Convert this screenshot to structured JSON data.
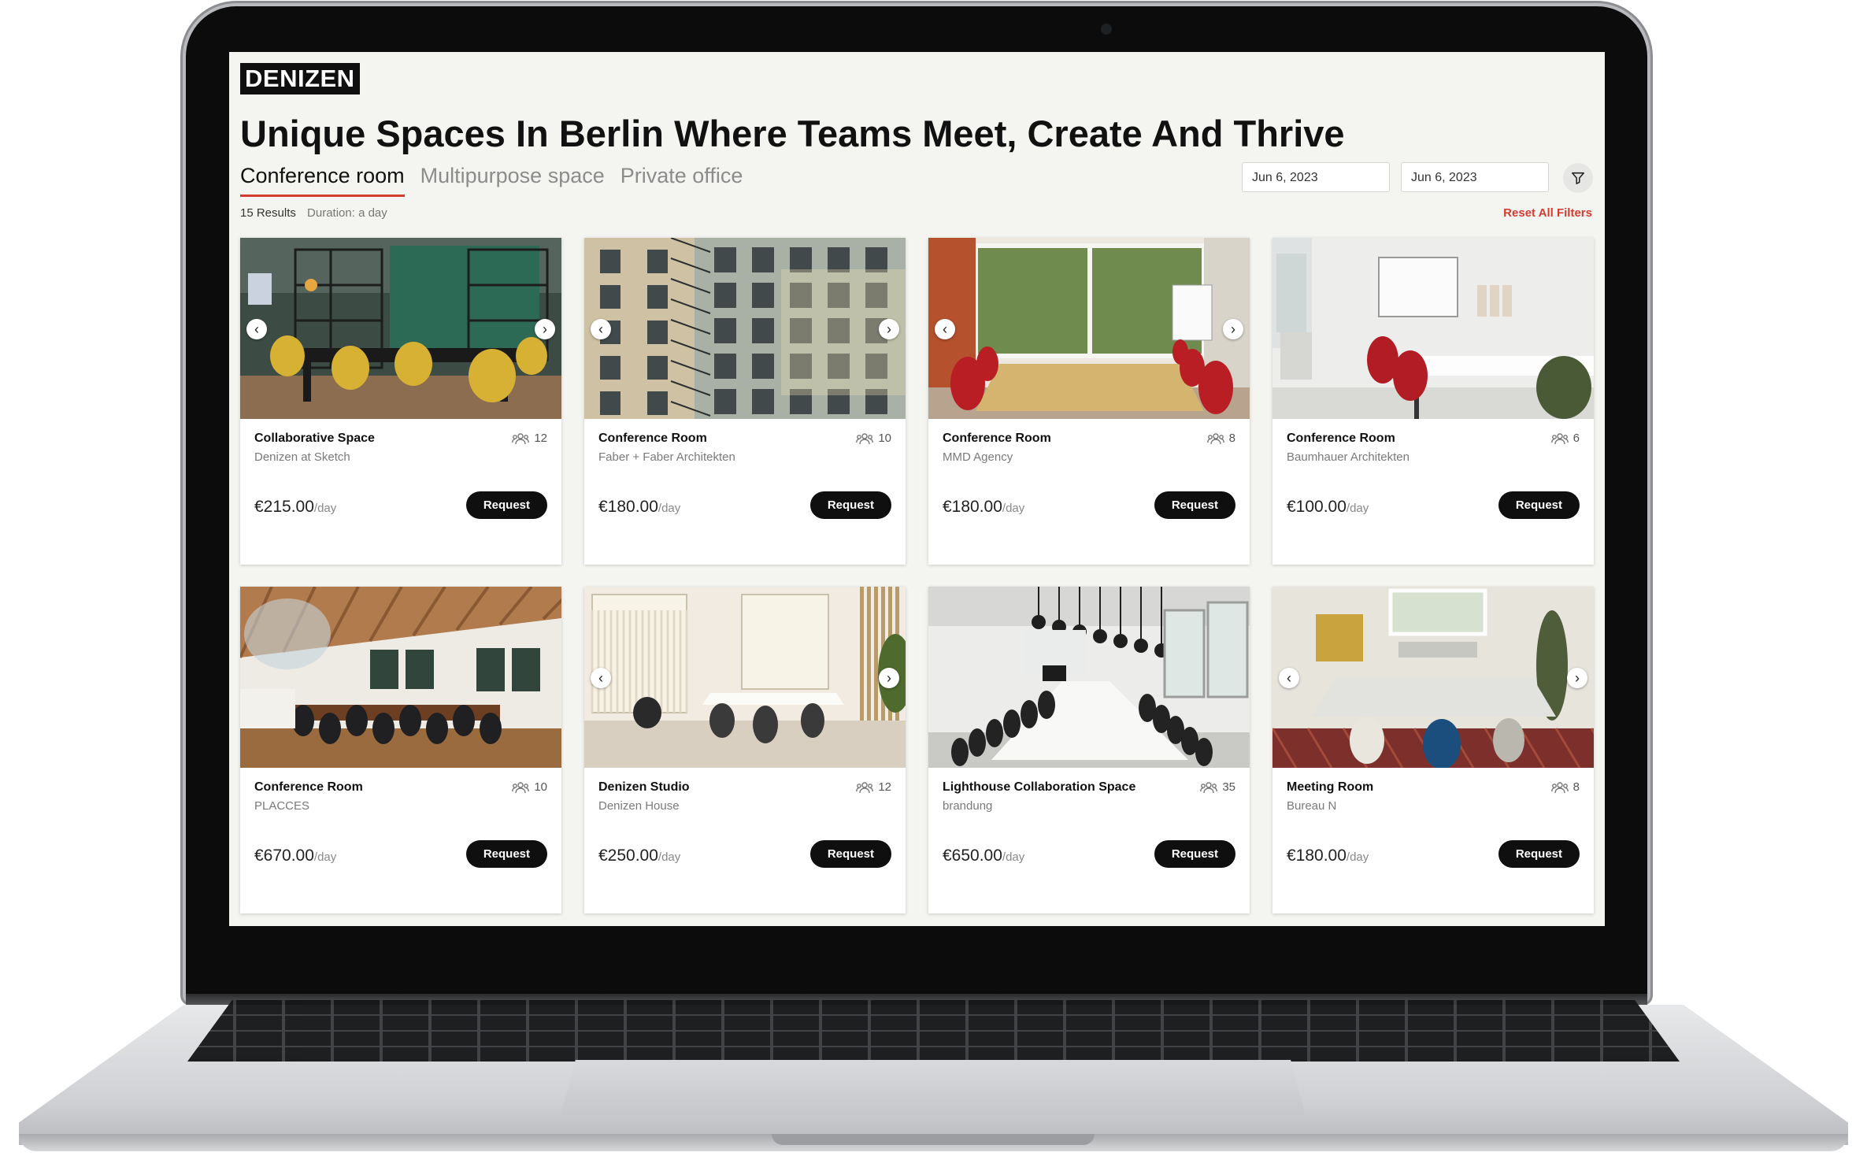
{
  "brand": {
    "logo_text": "DENIZEN"
  },
  "headline": "Unique Spaces In Berlin Where Teams Meet, Create And Thrive",
  "tabs": [
    {
      "label": "Conference room",
      "active": true
    },
    {
      "label": "Multipurpose space",
      "active": false
    },
    {
      "label": "Private office",
      "active": false
    }
  ],
  "dates": {
    "from": "Jun 6, 2023",
    "to": "Jun 6, 2023"
  },
  "results": {
    "count_text": "15 Results",
    "duration_text": "Duration: a day"
  },
  "reset_label": "Reset All Filters",
  "accent_color": "#d43c2f",
  "request_label": "Request",
  "price_unit": "/day",
  "listings": [
    {
      "title": "Collaborative Space",
      "host": "Denizen at Sketch",
      "capacity": "12",
      "price": "€215.00",
      "photo": "green-loft-yellow-chairs",
      "arrows": true
    },
    {
      "title": "Conference Room",
      "host": "Faber + Faber Architekten",
      "capacity": "10",
      "price": "€180.00",
      "photo": "building-courtyard",
      "arrows": true
    },
    {
      "title": "Conference Room",
      "host": "MMD Agency",
      "capacity": "8",
      "price": "€180.00",
      "photo": "red-chairs-table",
      "arrows": true
    },
    {
      "title": "Conference Room",
      "host": "Baumhauer Architekten",
      "capacity": "6",
      "price": "€100.00",
      "photo": "white-room-whiteboard",
      "arrows": false
    },
    {
      "title": "Conference Room",
      "host": "PLACCES",
      "capacity": "10",
      "price": "€670.00",
      "photo": "wooden-ceiling-room",
      "arrows": false
    },
    {
      "title": "Denizen Studio",
      "host": "Denizen House",
      "capacity": "12",
      "price": "€250.00",
      "photo": "bright-studio",
      "arrows": true
    },
    {
      "title": "Lighthouse Collaboration Space",
      "host": "brandung",
      "capacity": "35",
      "price": "€650.00",
      "photo": "long-table-hall",
      "arrows": false
    },
    {
      "title": "Meeting Room",
      "host": "Bureau N",
      "capacity": "8",
      "price": "€180.00",
      "photo": "meeting-room-rug",
      "arrows": true
    }
  ]
}
